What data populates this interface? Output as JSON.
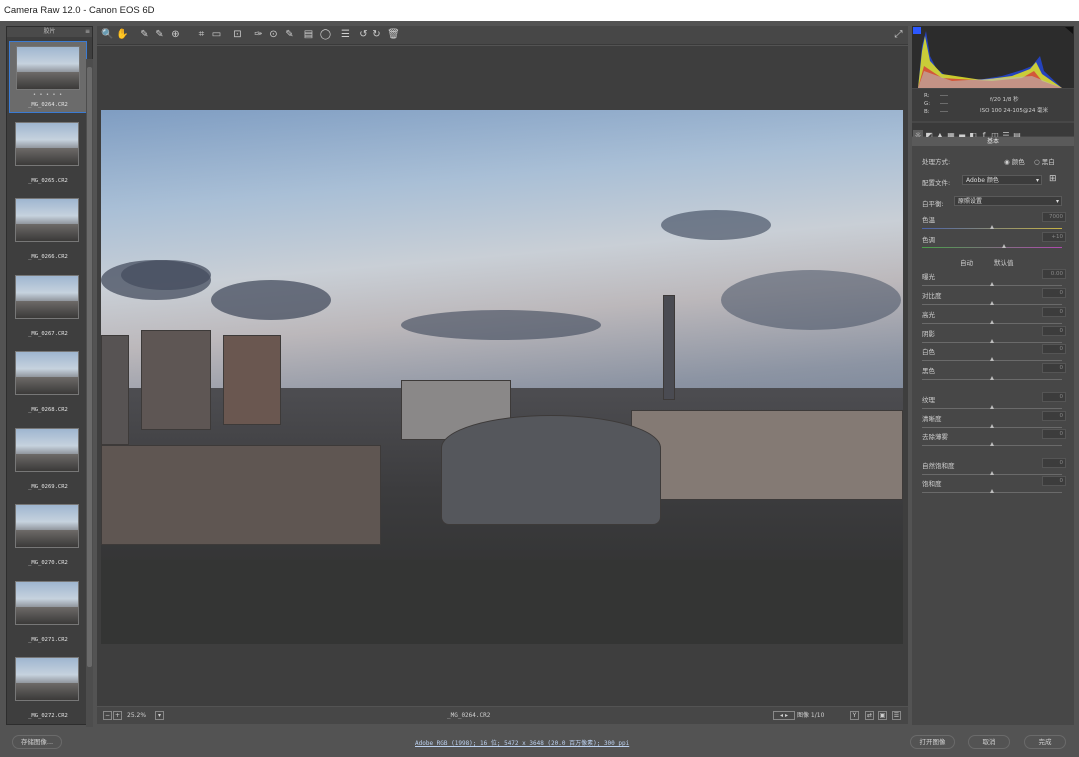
{
  "window": {
    "title": "Camera Raw 12.0 -  Canon EOS 6D"
  },
  "filmstrip": {
    "header": "胶片",
    "rating_dots": "• • • • •",
    "items": [
      {
        "name": "_MG_0264.CR2",
        "selected": true
      },
      {
        "name": "_MG_0265.CR2",
        "selected": false
      },
      {
        "name": "_MG_0266.CR2",
        "selected": false
      },
      {
        "name": "_MG_0267.CR2",
        "selected": false
      },
      {
        "name": "_MG_0268.CR2",
        "selected": false
      },
      {
        "name": "_MG_0269.CR2",
        "selected": false
      },
      {
        "name": "_MG_0270.CR2",
        "selected": false
      },
      {
        "name": "_MG_0271.CR2",
        "selected": false
      },
      {
        "name": "_MG_0272.CR2",
        "selected": false
      }
    ]
  },
  "toolbar": {
    "icons": [
      "zoom-icon",
      "hand-icon",
      "white-balance-icon",
      "color-sampler-icon",
      "targeted-adjust-icon",
      "crop-icon",
      "straighten-icon",
      "transform-icon",
      "spot-removal-icon",
      "red-eye-icon",
      "adjustment-brush-icon",
      "graduated-filter-icon",
      "radial-filter-icon",
      "presets-icon",
      "rotate-ccw-icon",
      "rotate-cw-icon",
      "trash-icon"
    ],
    "glyphs": [
      "🔍",
      "✋",
      "✎",
      "✎",
      "⊕",
      "⌗",
      "▭",
      "⊡",
      "✑",
      "⊙",
      "✎",
      "▤",
      "◯",
      "☰",
      "↺",
      "↻",
      "🗑"
    ]
  },
  "status": {
    "zoom": "25.2%",
    "filename": "_MG_0264.CR2",
    "image_index": "图像 1/10"
  },
  "histogram": {
    "r": "R:",
    "g": "G:",
    "b": "B:",
    "dash": "----",
    "exposure": "f/20  1/8 秒",
    "iso": "ISO 100  24-105@24 毫米"
  },
  "panel": {
    "section": "基本",
    "treatment_label": "处理方式:",
    "treatment_color": "颜色",
    "treatment_bw": "黑白",
    "profile_label": "配置文件:",
    "profile_value": "Adobe 颜色",
    "wb_label": "白平衡:",
    "wb_value": "原照设置",
    "temp_label": "色温",
    "temp_value": "7000",
    "tint_label": "色调",
    "tint_value": "+10",
    "auto": "自动",
    "default": "默认值",
    "exposure_label": "曝光",
    "exposure_value": "0.00",
    "contrast_label": "对比度",
    "contrast_value": "0",
    "highlights_label": "高光",
    "highlights_value": "0",
    "shadows_label": "阴影",
    "shadows_value": "0",
    "whites_label": "白色",
    "whites_value": "0",
    "blacks_label": "黑色",
    "blacks_value": "0",
    "texture_label": "纹理",
    "texture_value": "0",
    "clarity_label": "清晰度",
    "clarity_value": "0",
    "dehaze_label": "去除薄雾",
    "dehaze_value": "0",
    "vibrance_label": "自然饱和度",
    "vibrance_value": "0",
    "saturation_label": "饱和度",
    "saturation_value": "0"
  },
  "footer": {
    "save": "存储图像...",
    "info": "Adobe RGB (1998); 16 位; 5472 x 3648 (20.0 百万像素); 300 ppi",
    "open": "打开图像",
    "cancel": "取消",
    "done": "完成"
  },
  "colors": {
    "accent": "#3b7bd3",
    "panel": "#474747",
    "bg": "#535353"
  }
}
